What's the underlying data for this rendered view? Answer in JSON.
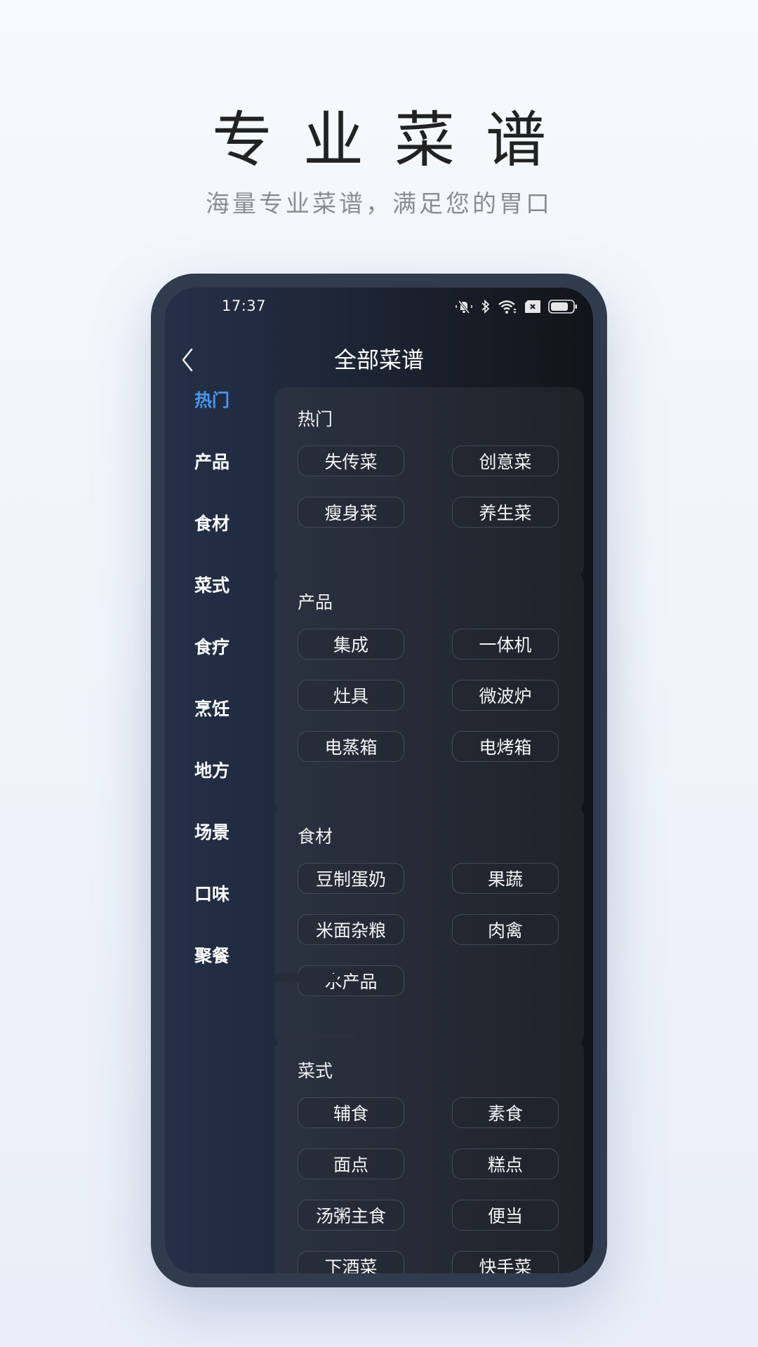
{
  "promo": {
    "title": "专业菜谱",
    "subtitle": "海量专业菜谱，满足您的胃口"
  },
  "status_bar": {
    "time": "17:37",
    "icons": [
      "bell-muted-icon",
      "bluetooth-icon",
      "wifi-icon",
      "sim-none-icon",
      "battery-icon"
    ]
  },
  "nav": {
    "back_icon": "chevron-left-icon",
    "title": "全部菜谱"
  },
  "colors": {
    "accent": "#4c95ec",
    "frame": "#303c4d"
  },
  "sidebar": {
    "active_index": 0,
    "items": [
      {
        "label": "热门"
      },
      {
        "label": "产品"
      },
      {
        "label": "食材"
      },
      {
        "label": "菜式"
      },
      {
        "label": "食疗"
      },
      {
        "label": "烹饪"
      },
      {
        "label": "地方"
      },
      {
        "label": "场景"
      },
      {
        "label": "口味"
      },
      {
        "label": "聚餐"
      }
    ]
  },
  "sections": [
    {
      "title": "热门",
      "chips": [
        "失传菜",
        "创意菜",
        "瘦身菜",
        "养生菜"
      ]
    },
    {
      "title": "产品",
      "chips": [
        "集成",
        "一体机",
        "灶具",
        "微波炉",
        "电蒸箱",
        "电烤箱"
      ]
    },
    {
      "title": "食材",
      "chips": [
        "豆制蛋奶",
        "果蔬",
        "米面杂粮",
        "肉禽",
        "水产品"
      ]
    },
    {
      "title": "菜式",
      "chips": [
        "辅食",
        "素食",
        "面点",
        "糕点",
        "汤粥主食",
        "便当",
        "下酒菜",
        "快手菜"
      ]
    }
  ]
}
